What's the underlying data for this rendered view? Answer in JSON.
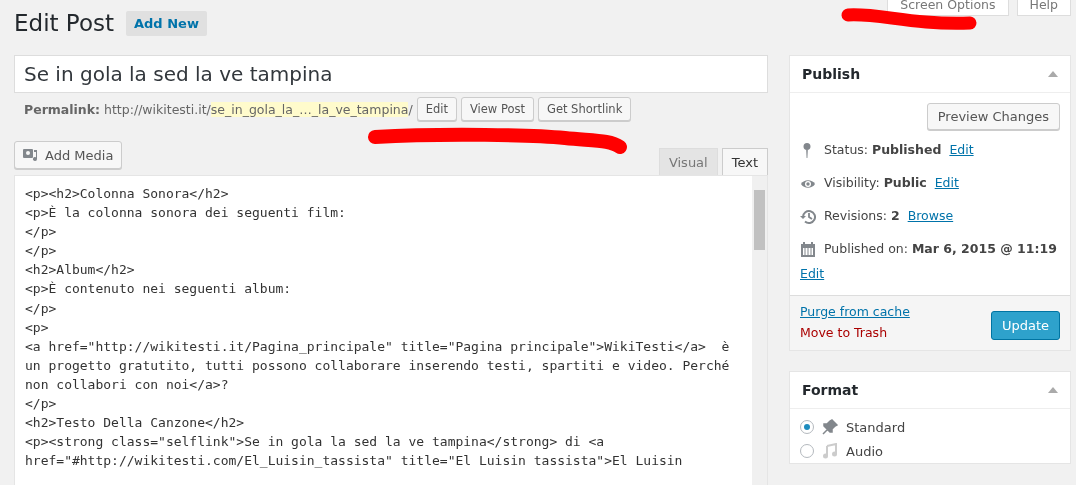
{
  "header": {
    "title": "Edit Post",
    "add_new": "Add New"
  },
  "screen_meta": [
    {
      "label": "Screen Options"
    },
    {
      "label": "Help"
    }
  ],
  "post_title": {
    "value": "Se in gola la sed la ve tampina"
  },
  "permalink": {
    "label": "Permalink:",
    "base": "http://wikitesti.it/",
    "slug": "se_in_gola_la_…_la_ve_tampina",
    "end": "/",
    "buttons": [
      "Edit",
      "View Post",
      "Get Shortlink"
    ]
  },
  "add_media": "Add Media",
  "editor_tabs": [
    {
      "label": "Visual",
      "selected": false
    },
    {
      "label": "Text",
      "selected": true
    }
  ],
  "code_lines": [
    "<p><h2>Colonna Sonora</h2>",
    "<p>È la colonna sonora dei seguenti film:",
    "</p>",
    "</p>",
    "<h2>Album</h2>",
    "<p>È contenuto nei seguenti album:",
    "</p>",
    "<p>",
    "<a href=\"http://wikitesti.it/Pagina_principale\" title=\"Pagina principale\">WikiTesti</a>  è",
    "un progetto gratutito, tutti possono collaborare inserendo testi, spartiti e video. Perché",
    "non collabori con noi</a>?",
    "</p>",
    "<h2>Testo Della Canzone</h2>",
    "<p><strong class=\"selflink\">Se in gola la sed la ve tampina</strong> di <a",
    "href=\"#http://wikitesti.com/El_Luisin_tassista\" title=\"El Luisin tassista\">El Luisin"
  ],
  "publish": {
    "title": "Publish",
    "preview": "Preview Changes",
    "rows": [
      {
        "kind": "status",
        "label": "Status:",
        "value": "Published",
        "link": "Edit"
      },
      {
        "kind": "visibility",
        "label": "Visibility:",
        "value": "Public",
        "link": "Edit"
      },
      {
        "kind": "revisions",
        "label": "Revisions:",
        "value": "2",
        "link": "Browse"
      },
      {
        "kind": "date",
        "label": "Published on:",
        "value": "Mar 6, 2015 @ 11:19",
        "link": "Edit"
      }
    ],
    "purge": "Purge from cache",
    "trash": "Move to Trash",
    "update": "Update"
  },
  "format": {
    "title": "Format",
    "options": [
      {
        "kind": "standard",
        "label": "Standard",
        "selected": true
      },
      {
        "kind": "audio",
        "label": "Audio",
        "selected": false
      }
    ]
  }
}
